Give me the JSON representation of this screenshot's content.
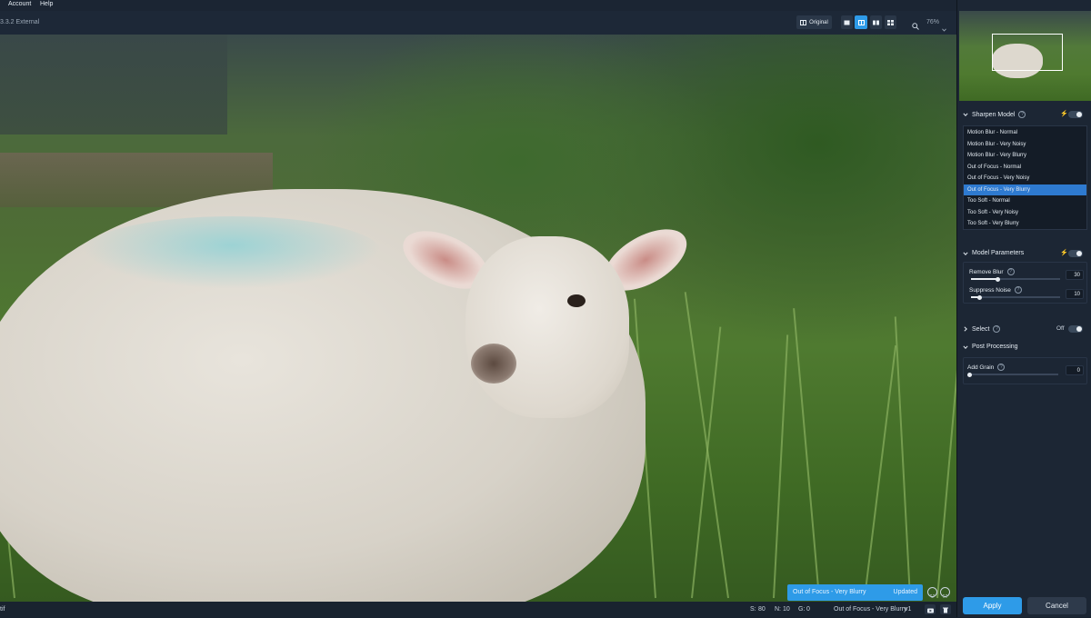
{
  "menubar": {
    "items": [
      {
        "label": "Account"
      },
      {
        "label": "Help"
      }
    ]
  },
  "toolbar": {
    "title": "3.3.2 External",
    "original_label": "Original",
    "zoom": "76%",
    "view_modes": [
      "single-view",
      "split-view",
      "side-by-side-view",
      "quad-view"
    ],
    "active_view": "split-view"
  },
  "preview": {
    "status_model": "Out of Focus - Very Blurry",
    "status_state": "Updated"
  },
  "bottombar": {
    "filename_suffix": "tif",
    "s_label": "S:",
    "s_value": "80",
    "n_label": "N:",
    "n_value": "10",
    "g_label": "G:",
    "g_value": "0",
    "model": "Out of Focus - Very Blurry",
    "version": "v1"
  },
  "sharpen": {
    "header": "Sharpen Model",
    "models": [
      "Motion Blur - Normal",
      "Motion Blur - Very Noisy",
      "Motion Blur - Very Blurry",
      "Out of Focus - Normal",
      "Out of Focus - Very Noisy",
      "Out of Focus - Very Blurry",
      "Too Soft - Normal",
      "Too Soft - Very Noisy",
      "Too Soft - Very Blurry"
    ],
    "selected": "Out of Focus - Very Blurry"
  },
  "model_parameters": {
    "header": "Model Parameters",
    "remove_blur": {
      "label": "Remove Blur",
      "value": "30",
      "fraction": 0.3
    },
    "suppress_noise": {
      "label": "Suppress Noise",
      "value": "10",
      "fraction": 0.1
    }
  },
  "select": {
    "header": "Select",
    "toggle_label": "Off"
  },
  "post_processing": {
    "header": "Post Processing",
    "add_grain": {
      "label": "Add Grain",
      "value": "0",
      "fraction": 0
    }
  },
  "actions": {
    "apply": "Apply",
    "cancel": "Cancel"
  },
  "colors": {
    "accent": "#2e9be8",
    "panel": "#1c2634",
    "selected_row": "#2e7ad0"
  },
  "icons": [
    "zoom-icon",
    "chevron-down-icon",
    "chevron-right-icon",
    "help-icon",
    "lightning-icon",
    "smile-icon",
    "frown-icon",
    "preview-icon",
    "trash-icon",
    "compare-icon"
  ]
}
